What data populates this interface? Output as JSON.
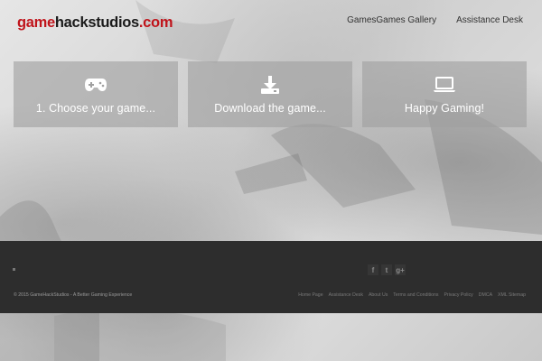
{
  "header": {
    "logo_part1": "game",
    "logo_part2": "hackstudios",
    "logo_part3": ".com",
    "nav": [
      {
        "label": "GamesGames Gallery"
      },
      {
        "label": "Assistance Desk"
      }
    ]
  },
  "cards": [
    {
      "label": "1. Choose your game...",
      "icon": "gamepad-icon"
    },
    {
      "label": "Download the game...",
      "icon": "download-icon"
    },
    {
      "label": "Happy Gaming!",
      "icon": "laptop-icon"
    }
  ],
  "footer": {
    "social": [
      {
        "icon": "facebook-icon",
        "glyph": "f"
      },
      {
        "icon": "twitter-icon",
        "glyph": "t"
      },
      {
        "icon": "google-plus-icon",
        "glyph": "g+"
      }
    ],
    "copyright": "© 2015 GameHackStudios - A Better Gaming Experience",
    "links": [
      {
        "label": "Home Page"
      },
      {
        "label": "Assistance Desk"
      },
      {
        "label": "About Us"
      },
      {
        "label": "Terms and Conditions"
      },
      {
        "label": "Privacy Policy"
      },
      {
        "label": "DMCA"
      },
      {
        "label": "XML Sitemap"
      }
    ]
  },
  "colors": {
    "brand_red": "#c0141b",
    "footer_bg": "#2d2d2d",
    "card_bg": "rgba(160,160,160,0.62)"
  }
}
